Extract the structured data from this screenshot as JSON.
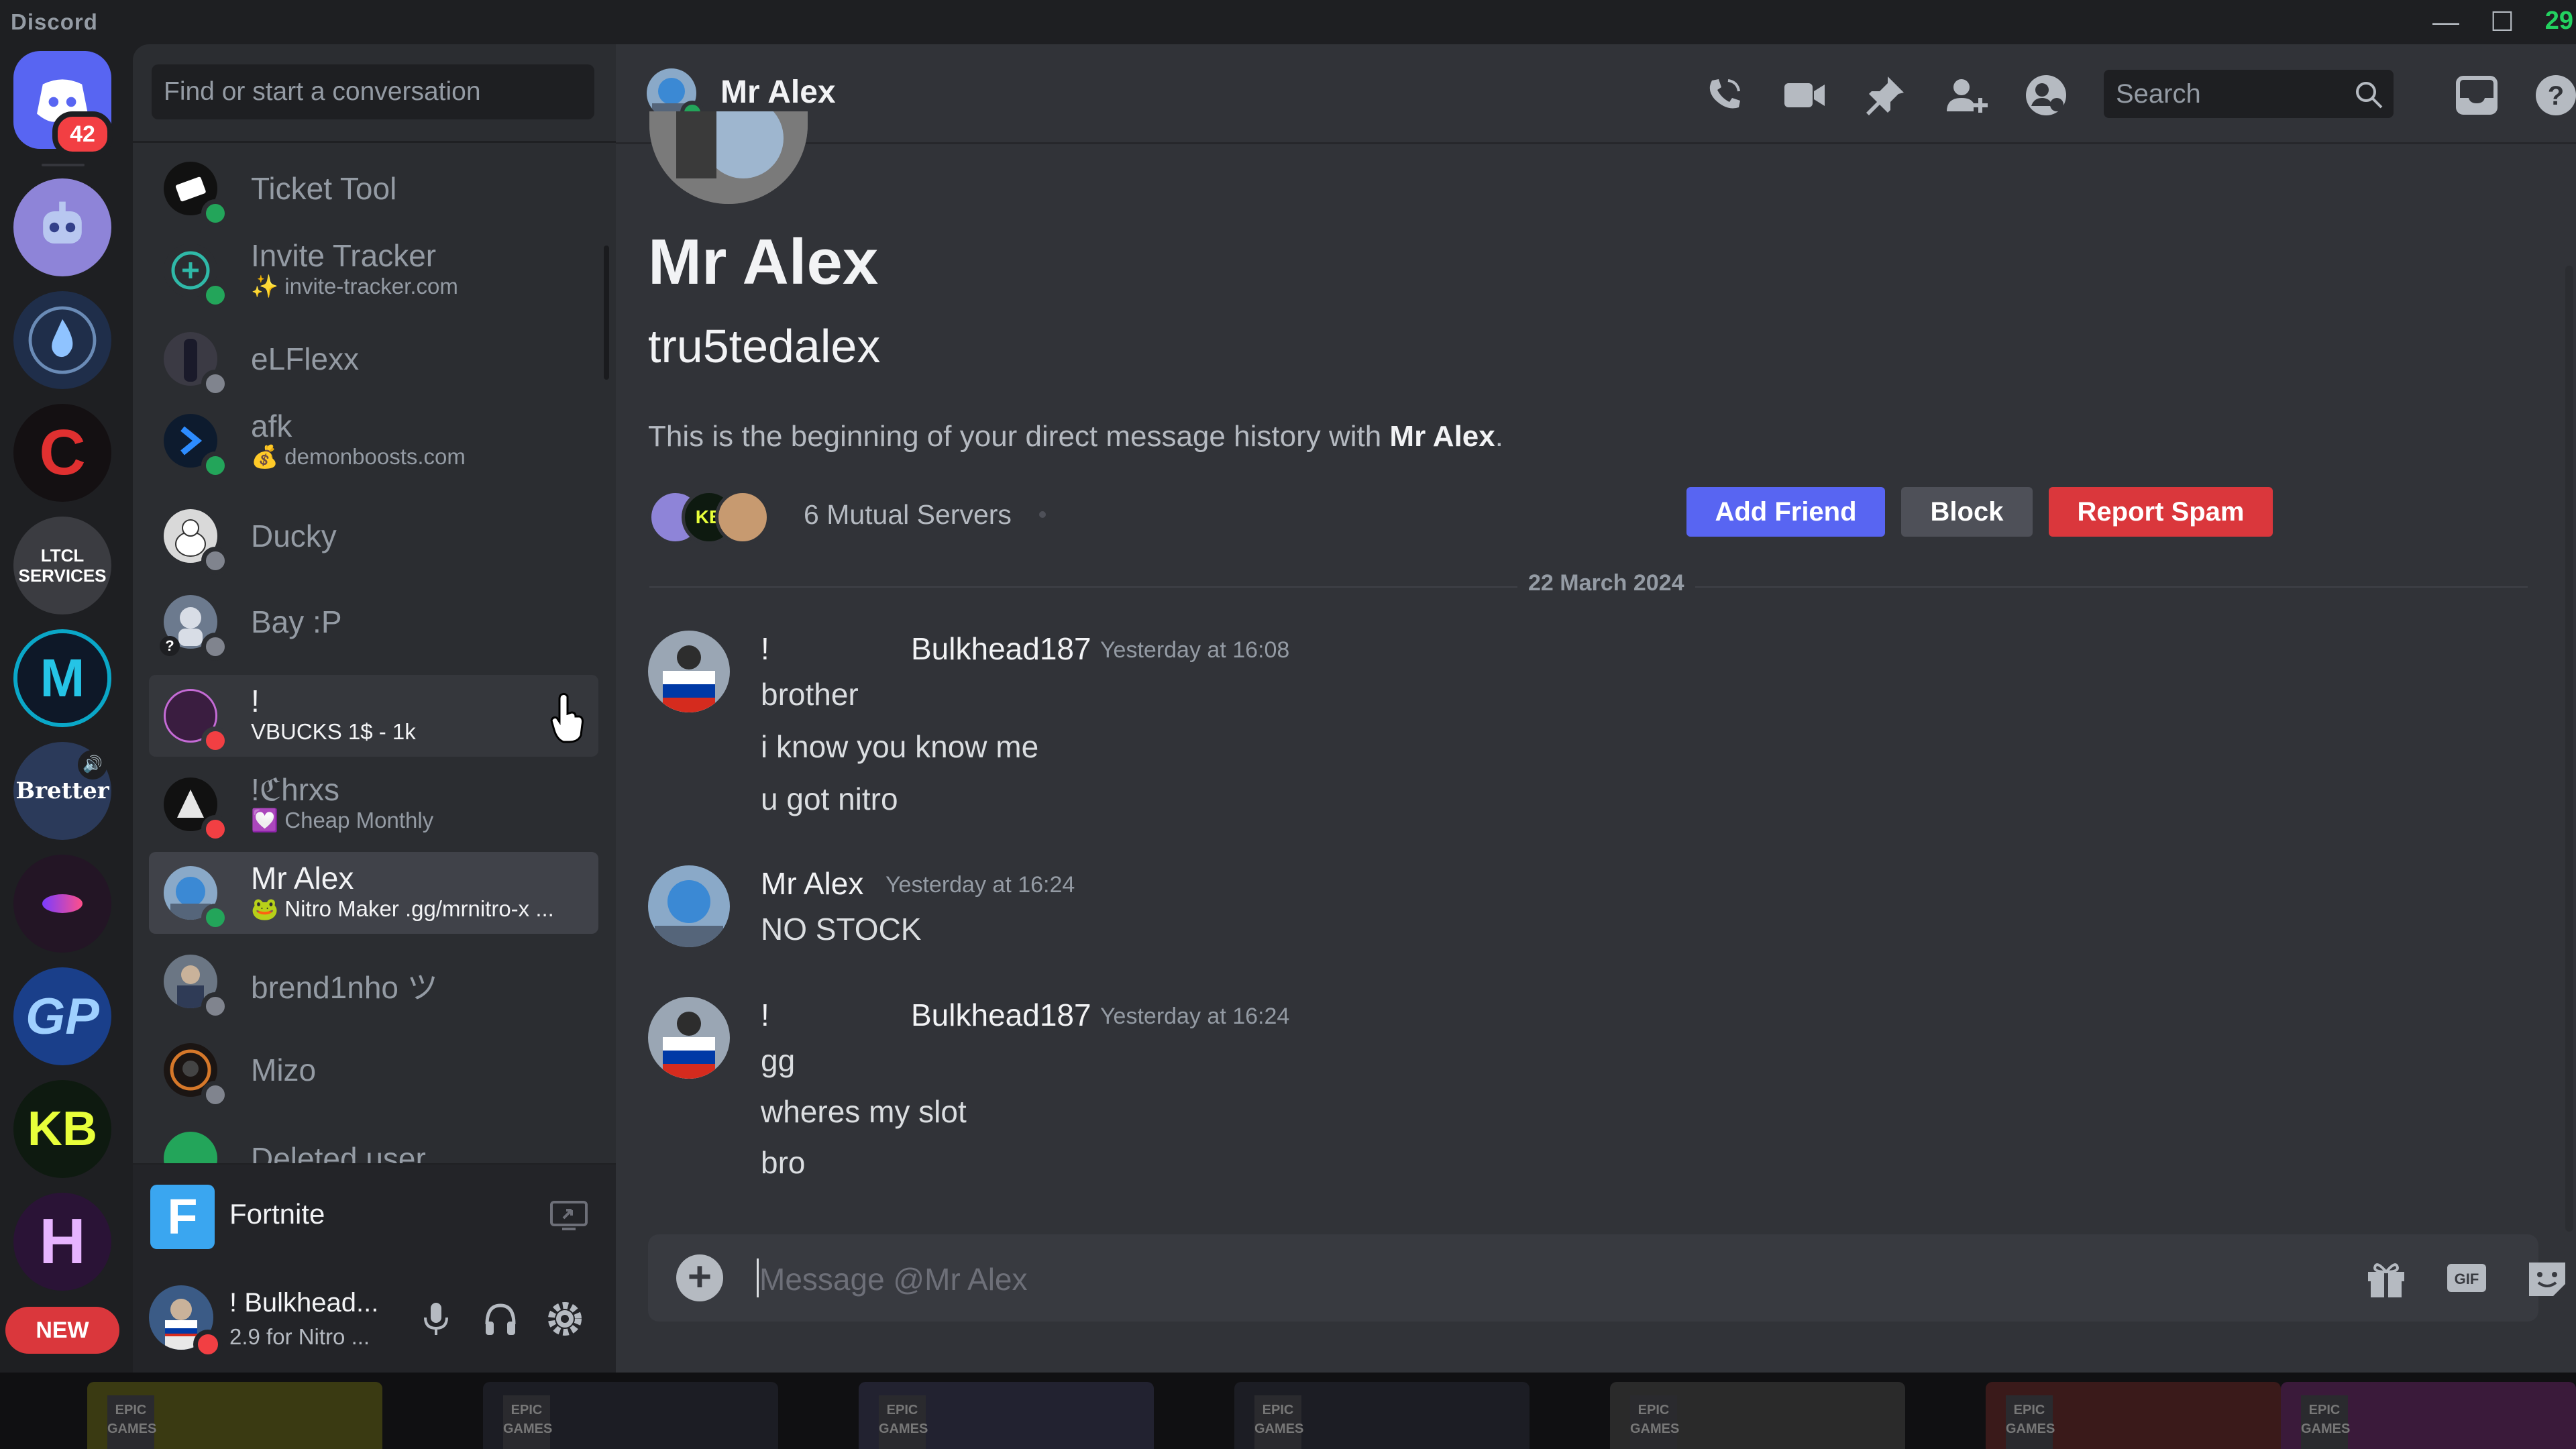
{
  "titlebar": {
    "brand": "Discord",
    "clock": "29"
  },
  "rail": {
    "home_badge": "42",
    "new_label": "NEW",
    "servers": [
      {
        "name": "robot-server",
        "label": "",
        "bg": "#8e84d8"
      },
      {
        "name": "droplet-server",
        "label": "",
        "bg": "#24395a"
      },
      {
        "name": "c-server",
        "label": "C",
        "bg": "#1a1414"
      },
      {
        "name": "ltcl-server",
        "label": "LTCL SERVICES",
        "bg": "#3b3c41"
      },
      {
        "name": "m-server",
        "label": "M",
        "bg": "#101a2a"
      },
      {
        "name": "bretter-server",
        "label": "Bretter",
        "bg": "#2b3a5a"
      },
      {
        "name": "purple-server",
        "label": "",
        "bg": "#2a1a2c"
      },
      {
        "name": "gp-server",
        "label": "GP",
        "bg": "#1a3f8a"
      },
      {
        "name": "kb-server",
        "label": "KB",
        "bg": "#0f1f10"
      },
      {
        "name": "h-server",
        "label": "H",
        "bg": "#2a1336"
      }
    ]
  },
  "dm_sidebar": {
    "search_placeholder": "Find or start a conversation",
    "dms": [
      {
        "name": "Ticket Tool",
        "sub": "",
        "status": "online"
      },
      {
        "name": "Invite Tracker",
        "sub": "✨ invite-tracker.com",
        "status": "online"
      },
      {
        "name": "eLFlexx",
        "sub": "",
        "status": "offline"
      },
      {
        "name": "afk",
        "sub": "💰 demonboosts.com",
        "status": "online"
      },
      {
        "name": "Ducky",
        "sub": "",
        "status": "offline"
      },
      {
        "name": "Bay :P",
        "sub": "",
        "status": "offline"
      },
      {
        "name": "!",
        "sub": "VBUCKS 1$ - 1k",
        "status": "dnd"
      },
      {
        "name": "!ℭhrxs",
        "sub": "💟 Cheap Monthly",
        "status": "dnd"
      },
      {
        "name": "Mr Alex",
        "sub": "🐸 Nitro Maker .gg/mrnitro-x ...",
        "status": "online"
      },
      {
        "name": "brend1nho ツ",
        "sub": "",
        "status": "offline"
      },
      {
        "name": "Mizo",
        "sub": "",
        "status": "offline"
      },
      {
        "name": "Deleted user",
        "sub": "",
        "status": ""
      }
    ],
    "activity": {
      "game_icon_letter": "F",
      "game_name": "Fortnite"
    },
    "user": {
      "name": "! Bulkhead...",
      "status_text": "2.9 for Nitro ..."
    }
  },
  "chat": {
    "header_title": "Mr Alex",
    "search_placeholder": "Search",
    "intro": {
      "display_name": "Mr Alex",
      "username": "tru5tedalex",
      "text_prefix": "This is the beginning of your direct message history with ",
      "text_name": "Mr Alex",
      "text_suffix": ".",
      "mutual_servers": "6 Mutual Servers",
      "add_friend": "Add Friend",
      "block": "Block",
      "report_spam": "Report Spam"
    },
    "date_divider": "22 March 2024",
    "messages": [
      {
        "author_prefix": "!",
        "author": "Bulkhead187",
        "time": "Yesterday at 16:08",
        "lines": [
          "brother",
          "i know you know me",
          "u got nitro"
        ]
      },
      {
        "author_prefix": "",
        "author": "Mr Alex",
        "time": "Yesterday at 16:24",
        "lines": [
          "NO STOCK"
        ]
      },
      {
        "author_prefix": "!",
        "author": "Bulkhead187",
        "time": "Yesterday at 16:24",
        "lines": [
          "gg",
          "wheres my slot",
          "bro"
        ]
      }
    ],
    "composer_placeholder": "Message @Mr Alex"
  },
  "colors": {
    "blurple": "#5865f2",
    "danger": "#da373c",
    "secondary": "#4e5058",
    "online": "#23a55a",
    "dnd": "#f23f43"
  }
}
